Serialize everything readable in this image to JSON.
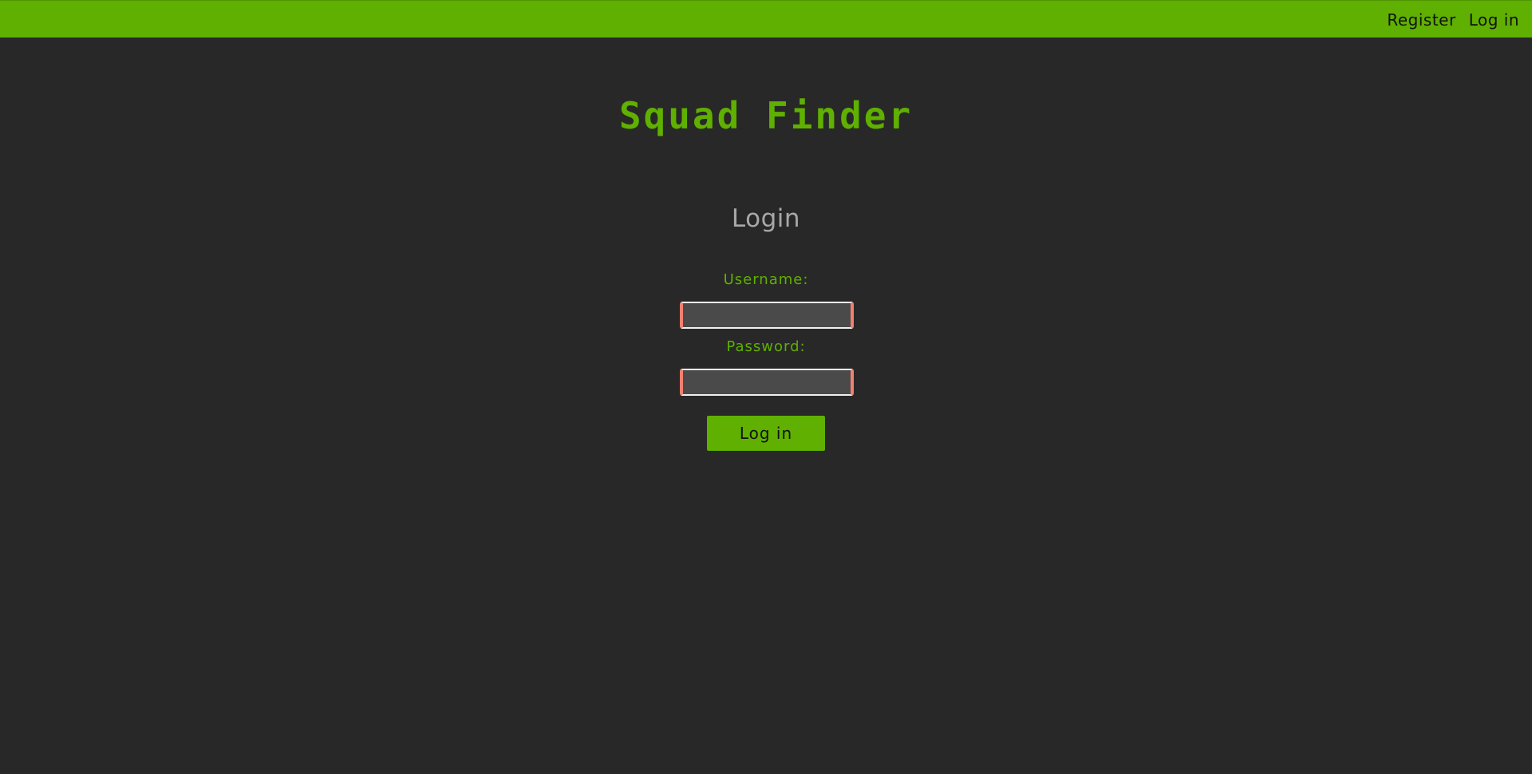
{
  "nav": {
    "register_label": "Register",
    "login_label": "Log in"
  },
  "site": {
    "title": "Squad Finder"
  },
  "form": {
    "heading": "Login",
    "username_label": "Username:",
    "username_value": "",
    "password_label": "Password:",
    "password_value": "",
    "submit_label": "Log in"
  },
  "colors": {
    "accent": "#5fb000",
    "background": "#282828",
    "input_bg": "#4a4a4a",
    "input_invalid_border": "#f08070",
    "heading_gray": "#a8a8a8"
  }
}
